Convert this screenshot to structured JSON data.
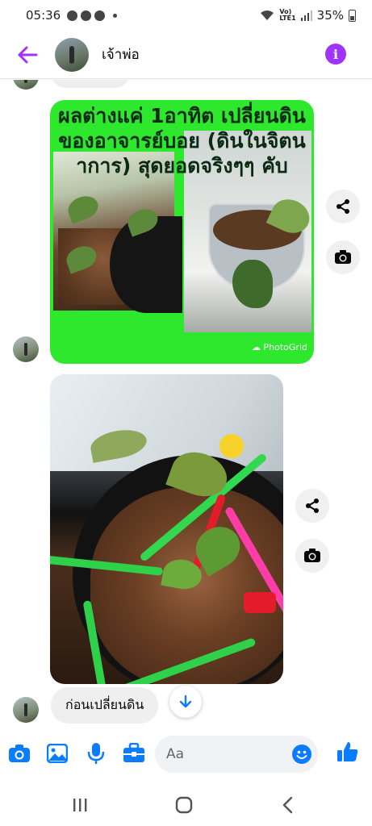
{
  "status_bar": {
    "time": "05:36",
    "network_top": "Vo)",
    "network_bottom": "LTE1",
    "battery": "35%"
  },
  "header": {
    "contact_name": "เจ้าพ่อ",
    "accent_color": "#a033ff"
  },
  "messages": {
    "photo1_caption": "ผลต่างแค่ 1อาทิต เปลี่ยนดินของอาจารย์บอย (ดินในจิตนาการ) สุดยอดจริงๆๆ คับ",
    "photo1_watermark": "PhotoGrid",
    "text_message": "ก่อนเปลี่ยนดิน"
  },
  "composer": {
    "placeholder": "Aa",
    "icon_color": "#0a7cff"
  },
  "icons": [
    "back-arrow-icon",
    "info-icon",
    "share-icon",
    "camera-icon",
    "image-icon",
    "microphone-icon",
    "toolbox-icon",
    "emoji-icon",
    "thumbs-up-icon",
    "arrow-down-icon",
    "recent-apps-icon",
    "home-icon",
    "nav-back-icon"
  ]
}
